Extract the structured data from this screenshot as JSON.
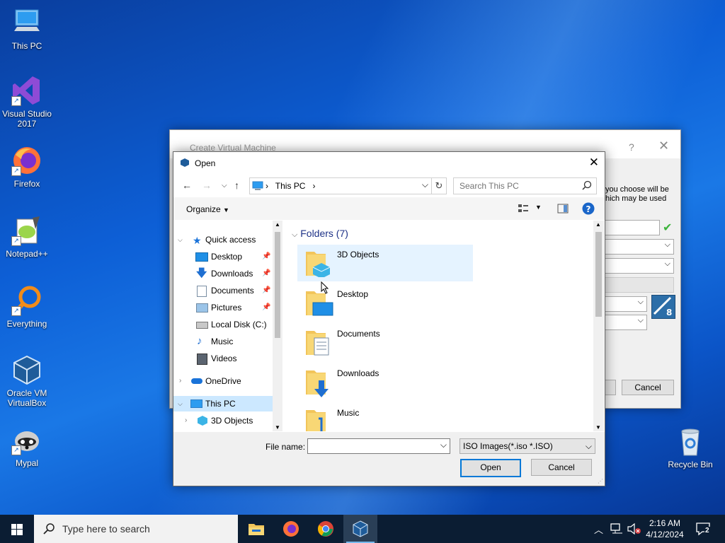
{
  "desktop": {
    "icons": [
      {
        "label": "This PC",
        "icon": "computer-icon"
      },
      {
        "label": "Visual Studio 2017",
        "icon": "visual-studio-icon"
      },
      {
        "label": "Firefox",
        "icon": "firefox-icon"
      },
      {
        "label": "Notepad++",
        "icon": "notepadpp-icon"
      },
      {
        "label": "Everything",
        "icon": "everything-search-icon"
      },
      {
        "label": "Oracle VM VirtualBox",
        "icon": "virtualbox-icon"
      },
      {
        "label": "Mypal",
        "icon": "mypal-icon"
      },
      {
        "label": "Recycle Bin",
        "icon": "recycle-bin-icon"
      }
    ]
  },
  "background_dialog": {
    "title": "Create Virtual Machine",
    "help": "?",
    "close": "✕",
    "text_line1": "you choose will be",
    "text_line2": "hich may be used",
    "cancel_label": "Cancel"
  },
  "open_dialog": {
    "title": "Open",
    "address": {
      "location": "This PC",
      "separator": "›"
    },
    "search_placeholder": "Search This PC",
    "organize_label": "Organize",
    "nav_tree": [
      {
        "label": "Quick access",
        "icon": "star-icon",
        "pinned": false
      },
      {
        "label": "Desktop",
        "icon": "desktop-folder-icon",
        "pinned": true
      },
      {
        "label": "Downloads",
        "icon": "download-arrow-icon",
        "pinned": true
      },
      {
        "label": "Documents",
        "icon": "documents-icon",
        "pinned": true
      },
      {
        "label": "Pictures",
        "icon": "pictures-icon",
        "pinned": true
      },
      {
        "label": "Local Disk (C:)",
        "icon": "disk-icon",
        "pinned": false
      },
      {
        "label": "Music",
        "icon": "music-note-icon",
        "pinned": false
      },
      {
        "label": "Videos",
        "icon": "videos-icon",
        "pinned": false
      },
      {
        "label": "OneDrive",
        "icon": "cloud-icon",
        "pinned": false
      },
      {
        "label": "This PC",
        "icon": "computer-icon",
        "pinned": false
      },
      {
        "label": "3D Objects",
        "icon": "cube-icon",
        "pinned": false
      }
    ],
    "folders_header": "Folders (7)",
    "folders": [
      {
        "name": "3D Objects",
        "selected": true
      },
      {
        "name": "Desktop",
        "selected": false
      },
      {
        "name": "Documents",
        "selected": false
      },
      {
        "name": "Downloads",
        "selected": false
      },
      {
        "name": "Music",
        "selected": false
      }
    ],
    "file_name_label": "File name:",
    "file_name_value": "",
    "file_type": "ISO Images(*.iso *.ISO)",
    "open_label": "Open",
    "cancel_label": "Cancel"
  },
  "taskbar": {
    "search_label": "Type here to search",
    "time": "2:16 AM",
    "date": "4/12/2024",
    "notification_count": "2"
  }
}
